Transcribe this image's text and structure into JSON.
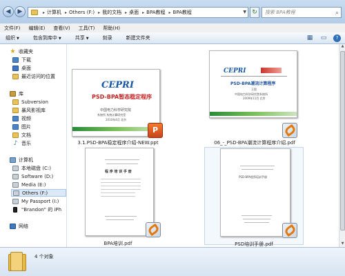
{
  "address": {
    "crumbs": [
      "计算机",
      "Others (F:)",
      "我的文档",
      "桌面",
      "BPA教程",
      "BPA教程"
    ]
  },
  "search": {
    "placeholder": "搜索 BPA教程"
  },
  "menu": [
    "文件(F)",
    "编辑(E)",
    "查看(V)",
    "工具(T)",
    "帮助(H)"
  ],
  "commands": [
    {
      "label": "组织",
      "dropdown": true
    },
    {
      "label": "包含到库中",
      "dropdown": true
    },
    {
      "label": "共享",
      "dropdown": true
    },
    {
      "label": "刻录",
      "dropdown": false
    },
    {
      "label": "新建文件夹",
      "dropdown": false
    }
  ],
  "nav": {
    "favorites": "收藏夹",
    "downloads": "下载",
    "desktop": "桌面",
    "recent": "最近访问的位置",
    "libraries": "库",
    "subversion": "Subversion",
    "baofeng": "暴风影视库",
    "videos": "视频",
    "pictures": "图片",
    "documents": "文档",
    "music": "音乐",
    "computer": "计算机",
    "local_c": "本地磁盘 (C:)",
    "software_d": "Software (D:)",
    "media_e": "Media (E:)",
    "others_f": "Others (F:)",
    "passport": "My Passport (I:)",
    "iphone": "\"Brandon\" 的 iPh",
    "network": "网络"
  },
  "files": [
    {
      "name": "3.1.PSD-BPA稳定程序介绍-NEW.ppt",
      "type": "ppt",
      "thumb": {
        "logo": "CEPRI",
        "title": "PSD-BPA暂态稳定程序",
        "org": "中国电力科学研究院",
        "sub": "系统所 系统计算研究室",
        "date": "2010年4月 北京"
      }
    },
    {
      "name": "06_-_PSD-BPA潮流计算程序介绍.pdf",
      "type": "pdf",
      "thumb": {
        "logo": "CEPRI",
        "title": "PSD-BPA潮流计算程序",
        "sub": "王毅",
        "org": "中国电力科学研究院系统所",
        "date": "2009年11月 北京"
      }
    },
    {
      "name": "BPA培训.pdf",
      "type": "pdf",
      "thumb": {
        "title": "程 序 培 训 手 册"
      }
    },
    {
      "name": "PSD培训手册.pdf",
      "type": "pdf",
      "thumb": {
        "title": "PSD-BPA程序培训手册"
      }
    }
  ],
  "status": {
    "count": "4 个对象"
  }
}
